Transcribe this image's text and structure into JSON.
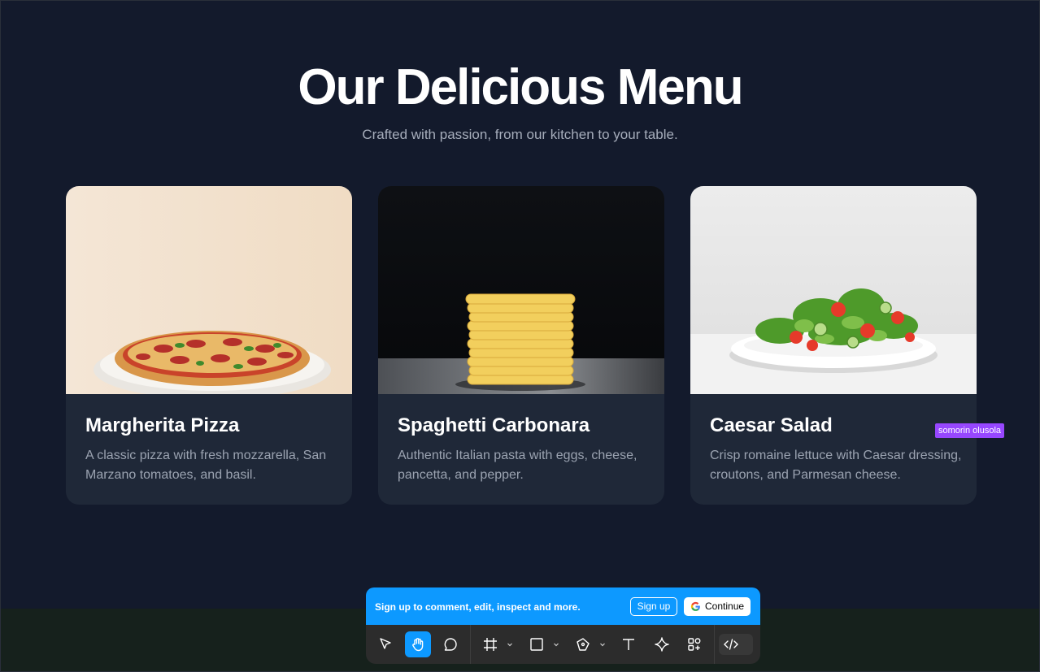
{
  "hero": {
    "title": "Our Delicious Menu",
    "subtitle": "Crafted with passion, from our kitchen to your table."
  },
  "cards": [
    {
      "title": "Margherita Pizza",
      "description": "A classic pizza with fresh mozzarella, San Marzano tomatoes, and basil.",
      "image": "pizza-photo"
    },
    {
      "title": "Spaghetti Carbonara",
      "description": "Authentic Italian pasta with eggs, cheese, pancetta, and pepper.",
      "image": "pasta-photo"
    },
    {
      "title": "Caesar Salad",
      "description": "Crisp romaine lettuce with Caesar dressing, croutons, and Parmesan cheese.",
      "image": "salad-photo"
    }
  ],
  "cursor_tag": {
    "label": "somorin olusola",
    "color": "#9747ff"
  },
  "signup": {
    "message": "Sign up to comment, edit, inspect and more.",
    "signup_label": "Sign up",
    "continue_label": "Continue",
    "color": "#0d99ff"
  },
  "toolbar": {
    "tools": [
      "move-icon",
      "hand-icon",
      "comment-icon",
      "frame-icon",
      "rectangle-icon",
      "pen-icon",
      "text-icon",
      "component-icon",
      "actions-icon",
      "code-icon"
    ],
    "active_tool": "hand-icon"
  },
  "colors": {
    "background": "#131a2c",
    "card": "#1f2838",
    "accent": "#0d99ff"
  }
}
